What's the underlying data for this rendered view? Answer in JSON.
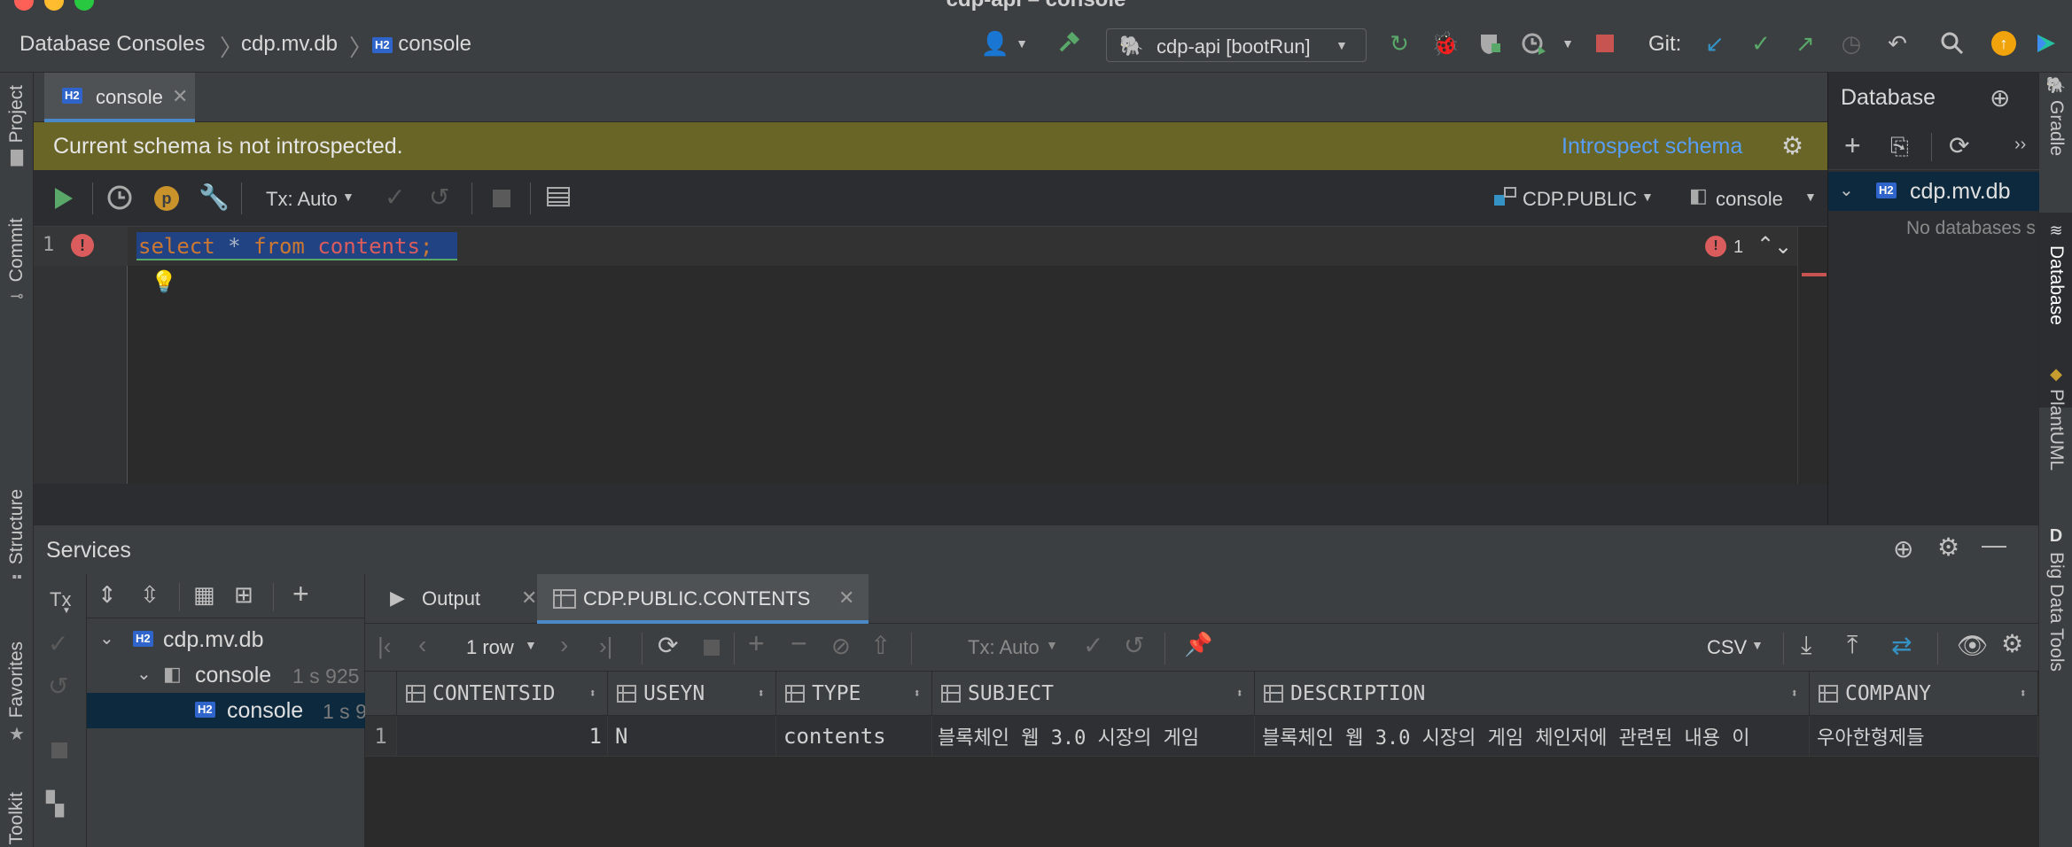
{
  "window": {
    "title": "cdp-api – console"
  },
  "breadcrumb": {
    "root": "Database Consoles",
    "db": "cdp.mv.db",
    "console": "console"
  },
  "toolbar": {
    "run_config": "cdp-api [bootRun]",
    "git_label": "Git:"
  },
  "left_strip": {
    "project": "Project",
    "commit": "Commit",
    "structure": "Structure",
    "favorites": "Favorites",
    "toolkit": "Toolkit"
  },
  "right_strip": {
    "gradle": "Gradle",
    "database": "Database",
    "plantuml": "PlantUML",
    "bigdata": "Big Data Tools"
  },
  "editor": {
    "tab_label": "console",
    "banner_text": "Current schema is not introspected.",
    "banner_link": "Introspect schema",
    "tx_mode": "Tx: Auto",
    "schema": "CDP.PUBLIC",
    "session": "console",
    "line_number": "1",
    "code": {
      "kw1": "select",
      "star": "*",
      "kw2": "from",
      "table": "contents",
      "semi": ";"
    },
    "error_count": "1"
  },
  "database_panel": {
    "title": "Database",
    "root_item": "cdp.mv.db",
    "empty_text": "No databases s"
  },
  "services": {
    "title": "Services",
    "tx_label": "Tx",
    "tree": {
      "db": "cdp.mv.db",
      "console": "console",
      "console_time": "1 s 925",
      "session": "console",
      "session_time": "1 s 9"
    }
  },
  "results": {
    "tabs": [
      "Output",
      "CDP.PUBLIC.CONTENTS"
    ],
    "rows_label": "1 row",
    "tx_mode": "Tx: Auto",
    "export_format": "CSV",
    "columns": [
      "CONTENTSID",
      "USEYN",
      "TYPE",
      "SUBJECT",
      "DESCRIPTION",
      "COMPANY"
    ],
    "rows": [
      {
        "num": "1",
        "cells": [
          "1",
          "N",
          "contents",
          "블록체인 웹 3.0 시장의 게임",
          "블록체인 웹 3.0 시장의 게임 체인저에 관련된 내용 이",
          "우아한형제들"
        ]
      }
    ]
  },
  "colors": {
    "accent": "#4a88c7",
    "banner": "#696527",
    "run_green": "#59a869",
    "stop_red": "#c75450",
    "error_red": "#db5c5c",
    "link_blue": "#589df6"
  }
}
